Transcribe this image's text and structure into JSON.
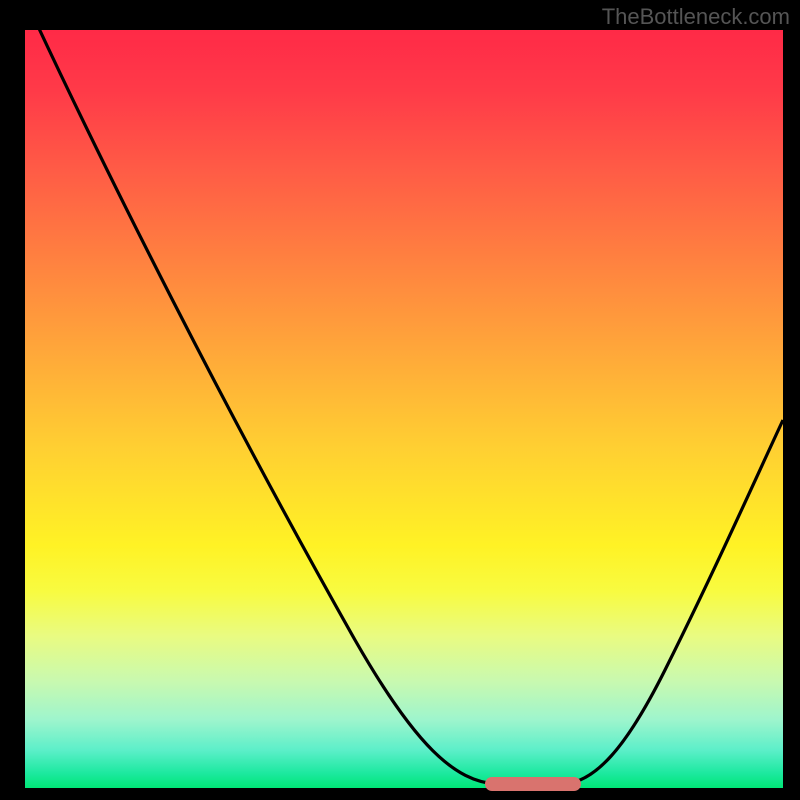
{
  "watermark": "TheBottleneck.com",
  "colors": {
    "background": "#000000",
    "curve": "#000000",
    "accent": "#d9736e"
  },
  "chart_data": {
    "type": "line",
    "title": "",
    "xlabel": "",
    "ylabel": "",
    "xlim": [
      0,
      100
    ],
    "ylim": [
      0,
      100
    ],
    "grid": false,
    "series": [
      {
        "name": "bottleneck-curve",
        "x": [
          5,
          10,
          15,
          20,
          25,
          30,
          35,
          40,
          45,
          50,
          55,
          60,
          62,
          65,
          70,
          72,
          75,
          80,
          85,
          90,
          95,
          100
        ],
        "values": [
          100,
          92,
          84,
          76,
          68,
          60,
          51,
          43,
          34,
          26,
          17,
          8,
          4,
          1,
          0,
          1,
          4,
          12,
          22,
          33,
          45,
          58
        ]
      }
    ],
    "accent_segment": {
      "x_start": 62,
      "x_end": 72,
      "y": 0
    }
  }
}
